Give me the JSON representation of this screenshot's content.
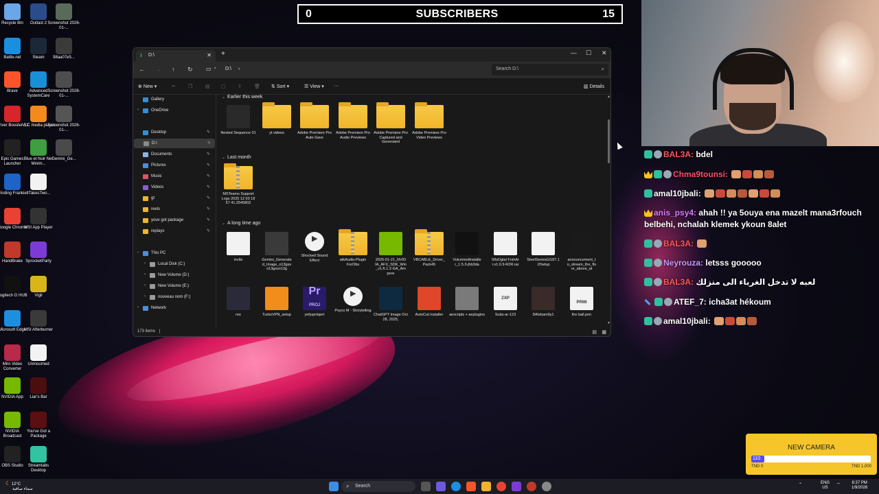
{
  "desktop_icons": [
    {
      "label": "Recycle Bin",
      "icon": "recycle-bin-icon",
      "color": "#6aa6e8"
    },
    {
      "label": "Outlast 2",
      "icon": "outlast-icon",
      "color": "#2a4c8a"
    },
    {
      "label": "Screenshot 2026-01-...",
      "icon": "screenshot-icon",
      "color": "#5a6a5a"
    },
    {
      "label": "Battle.net",
      "icon": "battlenet-icon",
      "color": "#1a8fe0"
    },
    {
      "label": "Steam",
      "icon": "steam-icon",
      "color": "#1b2838"
    },
    {
      "label": "98aa07e5...",
      "icon": "image-file-icon",
      "color": "#3b3b3b"
    },
    {
      "label": "Brave",
      "icon": "brave-icon",
      "color": "#fb542b"
    },
    {
      "label": "Advanced SystemCare",
      "icon": "systemcare-icon",
      "color": "#1790d8"
    },
    {
      "label": "Screenshot 2026-01-...",
      "icon": "screenshot-icon",
      "color": "#4d4d4d"
    },
    {
      "label": "Driver Booster 13",
      "icon": "driver-booster-icon",
      "color": "#d7262b"
    },
    {
      "label": "VLC media player",
      "icon": "vlc-icon",
      "color": "#f48a1c"
    },
    {
      "label": "Screenshot 2026-01-...",
      "icon": "screenshot-icon",
      "color": "#555"
    },
    {
      "label": "Epic Games Launcher",
      "icon": "epic-icon",
      "color": "#222"
    },
    {
      "label": "Blue et Noir Net Minim...",
      "icon": "image-file-icon",
      "color": "#3f9e3f"
    },
    {
      "label": "Gemini_Ge...",
      "icon": "image-file-icon",
      "color": "#4a4a4a"
    },
    {
      "label": "Finding Frankie",
      "icon": "finding-frankie-icon",
      "color": "#1d63c8"
    },
    {
      "label": "ItTakesTwo...",
      "icon": "file-icon",
      "color": "#f2f2f2"
    },
    {
      "label": "Google Chrome",
      "icon": "chrome-icon",
      "color": "#e94235"
    },
    {
      "label": "MSI App Player",
      "icon": "msi-app-player-icon",
      "color": "#333"
    },
    {
      "label": "HandBrake",
      "icon": "handbrake-icon",
      "color": "#c0392b"
    },
    {
      "label": "SprocketParty",
      "icon": "party-icon",
      "color": "#7d3bd6"
    },
    {
      "label": "Logitech G HUB",
      "icon": "logitech-icon",
      "color": "#111"
    },
    {
      "label": "Vigil",
      "icon": "vigil-icon",
      "color": "#d8b61a"
    },
    {
      "label": "Microsoft Edge",
      "icon": "edge-icon",
      "color": "#1d8fe0"
    },
    {
      "label": "MSI Afterburner",
      "icon": "afterburner-icon",
      "color": "#3a3a3a"
    },
    {
      "label": "Miro Video Converter",
      "icon": "miro-icon",
      "color": "#b8294a"
    },
    {
      "label": "Unmourned",
      "icon": "unmourned-icon",
      "color": "#f2f2f2"
    },
    {
      "label": "NVIDIA App",
      "icon": "nvidia-icon",
      "color": "#76b900"
    },
    {
      "label": "Liar's Bar",
      "icon": "liars-bar-icon",
      "color": "#4a0e0e"
    },
    {
      "label": "NVIDIA Broadcast",
      "icon": "nvidia-broadcast-icon",
      "color": "#76b900"
    },
    {
      "label": "You've Got a Package",
      "icon": "package-icon",
      "color": "#5a1010"
    },
    {
      "label": "OBS Studio",
      "icon": "obs-icon",
      "color": "#222"
    },
    {
      "label": "Streamlabs Desktop",
      "icon": "streamlabs-icon",
      "color": "#31c3a2"
    }
  ],
  "subscriber_bar": {
    "left": "0",
    "title": "SUBSCRIBERS",
    "right": "15"
  },
  "explorer": {
    "tab_title": "D:\\",
    "path_drive": "D:\\",
    "search_placeholder": "Search D:\\",
    "toolbar": {
      "new": "New",
      "sort": "Sort",
      "view": "View",
      "more": "···",
      "details": "Details"
    },
    "nav": [
      {
        "label": "Gallery",
        "color": "#2f8fd8"
      },
      {
        "label": "OneDrive",
        "color": "#2f8fd8"
      },
      {
        "label": "Desktop",
        "color": "#2f8fd8"
      },
      {
        "label": "D:\\",
        "color": "#8a8a8a"
      },
      {
        "label": "Documents",
        "color": "#8ab4e8"
      },
      {
        "label": "Pictures",
        "color": "#4a8ee0"
      },
      {
        "label": "Music",
        "color": "#e0506a"
      },
      {
        "label": "Videos",
        "color": "#8a5ad8"
      },
      {
        "label": "gt",
        "color": "#f0b429"
      },
      {
        "label": "reels",
        "color": "#f0b429"
      },
      {
        "label": "youv got package",
        "color": "#f0b429"
      },
      {
        "label": "replays",
        "color": "#f0b429"
      },
      {
        "label": "This PC",
        "color": "#4a8ee0"
      },
      {
        "label": "Local Disk (C:)",
        "color": "#9a9a9a"
      },
      {
        "label": "New Volume (D:)",
        "color": "#9a9a9a"
      },
      {
        "label": "New Volume (E:)",
        "color": "#9a9a9a"
      },
      {
        "label": "nouveau nom (F:)",
        "color": "#9a9a9a"
      },
      {
        "label": "Network",
        "color": "#4a8ee0"
      }
    ],
    "groups": [
      {
        "label": "Earlier this week"
      },
      {
        "label": "Last month"
      },
      {
        "label": "A long time ago"
      }
    ],
    "files_week": [
      {
        "name": "Nested Sequence 01",
        "kind": "video",
        "color": "#2a2a2a"
      },
      {
        "name": "yt videos",
        "kind": "folder",
        "color": "#f0b429"
      },
      {
        "name": "Adobe Premiere Pro Auto-Save",
        "kind": "folder",
        "color": "#f0b429"
      },
      {
        "name": "Adobe Premiere Pro Audio Previews",
        "kind": "folder",
        "color": "#f0b429"
      },
      {
        "name": "Adobe Premiere Pro Captured and Generated",
        "kind": "folder",
        "color": "#f0b429"
      },
      {
        "name": "Adobe Premiere Pro Video Previews",
        "kind": "folder",
        "color": "#f0b429"
      }
    ],
    "files_month": [
      {
        "name": "MSTeams Support Logs 2025 12 03 18 57 41.2545802",
        "kind": "zip-folder",
        "color": "#f0b429"
      }
    ],
    "files_old_row1": [
      {
        "name": "invite",
        "kind": "app",
        "color": "#f2f2f2"
      },
      {
        "name": "Gemini_Generate d_Image_o13gss o13gsso13g",
        "kind": "image",
        "color": "#3a3a3a"
      },
      {
        "name": "Shocked Sound Effect",
        "kind": "media",
        "color": "#f2f2f2"
      },
      {
        "name": "atkAudio-Plugin ForObs",
        "kind": "zip-folder",
        "color": "#f0b429"
      },
      {
        "name": "2025-01-21_NVID IA_AFX_SDK_Win _v1.6.1.2-GA_Am pere",
        "kind": "nvidia",
        "color": "#76b900"
      },
      {
        "name": "VBCABLE_Driver_ Pack45",
        "kind": "zip-folder",
        "color": "#f0b429"
      },
      {
        "name": "Voicemodinstalle r_1.5.3-jhb3da",
        "kind": "voicemod",
        "color": "#111"
      },
      {
        "name": "5ftsDgtal FrshAr r.v1.0.9-R2R.rar",
        "kind": "file",
        "color": "#f2f2f2"
      },
      {
        "name": "SteelSeriesGG97.1 .0Setup",
        "kind": "steelseries",
        "color": "#f2f2f2"
      },
      {
        "name": "announcement_t o_stream_the_flo or_above_at",
        "kind": "image",
        "color": "#1a1a1a"
      }
    ],
    "files_old_row2": [
      {
        "name": "res",
        "kind": "image",
        "color": "#2a2a3a"
      },
      {
        "name": "TurboVPN_setup",
        "kind": "setup",
        "color": "#f28c1a"
      },
      {
        "name": "yefyqertqert",
        "kind": "premiere",
        "color": "#2a1a6a"
      },
      {
        "name": "Psyco M - Storytelling",
        "kind": "media",
        "color": "#f2f2f2"
      },
      {
        "name": "ChatGPT Image Oct 28, 2025,",
        "kind": "image",
        "color": "#0e2a40"
      },
      {
        "name": "AutoCut.Installer",
        "kind": "installer",
        "color": "#e0462a"
      },
      {
        "name": "aescripts + aeplugins",
        "kind": "aescripts",
        "color": "#7a7a7a"
      },
      {
        "name": "Subs-ar-123",
        "kind": "zxp",
        "color": "#f2f2f2"
      },
      {
        "name": "3l4tzbam9y1",
        "kind": "image",
        "color": "#3a2a2a"
      },
      {
        "name": "fire ball.prin",
        "kind": "prin",
        "color": "#f2f2f2"
      }
    ],
    "premiere_label": "PROJ",
    "zxp_label": "ZXP",
    "prin_label": "PRMI",
    "status_items": "173 items"
  },
  "chat": [
    {
      "badges": [
        "mod",
        "sub"
      ],
      "user": "BAL3A:",
      "user_color": "#ff5a5a",
      "text": "bdel",
      "emotes": 0
    },
    {
      "badges": [
        "crown",
        "mod",
        "sub"
      ],
      "user": "Chma9tounsi:",
      "user_color": "#ff4d6a",
      "text": "",
      "emotes": 4
    },
    {
      "badges": [
        "mod"
      ],
      "user": "amal10jbali:",
      "user_color": "#ffffff",
      "text": "",
      "emotes": 7
    },
    {
      "badges": [
        "crown"
      ],
      "user": "anis_psy4:",
      "user_color": "#d97aff",
      "text": "ahah !! ya 5ouya ena mazelt mana3rfouch belbehi, nchalah klemek ykoun 8alet",
      "emotes": 0
    },
    {
      "badges": [
        "mod",
        "sub"
      ],
      "user": "BAL3A:",
      "user_color": "#ff5a5a",
      "text": "",
      "emotes": 1
    },
    {
      "badges": [
        "mod",
        "sub"
      ],
      "user": "Neyrouza:",
      "user_color": "#c69bff",
      "text": "letsss gooooo",
      "emotes": 0
    },
    {
      "badges": [
        "mod",
        "sub"
      ],
      "user": "BAL3A:",
      "user_color": "#ff5a5a",
      "text": "لعبه لا تدخل الغرباء الى منزلك",
      "emotes": 0
    },
    {
      "badges": [
        "sword",
        "mod",
        "sub"
      ],
      "user": "ATEF_7:",
      "user_color": "#ffffff",
      "text": "icha3at hékoum",
      "emotes": 0
    },
    {
      "badges": [
        "mod",
        "sub"
      ],
      "user": "amal10jbali:",
      "user_color": "#ffffff",
      "text": "",
      "emotes": 4
    }
  ],
  "goal": {
    "title": "NEW CAMERA",
    "current": "110",
    "progress": 0.11,
    "low": "TND 0",
    "high": "TND 1,000"
  },
  "taskbar": {
    "weather_temp": "12°C",
    "weather_desc": "سماء صافية",
    "search_label": "Search",
    "lang": "ENG",
    "region": "US",
    "time": "8:37 PM",
    "date": "1/9/2026"
  }
}
